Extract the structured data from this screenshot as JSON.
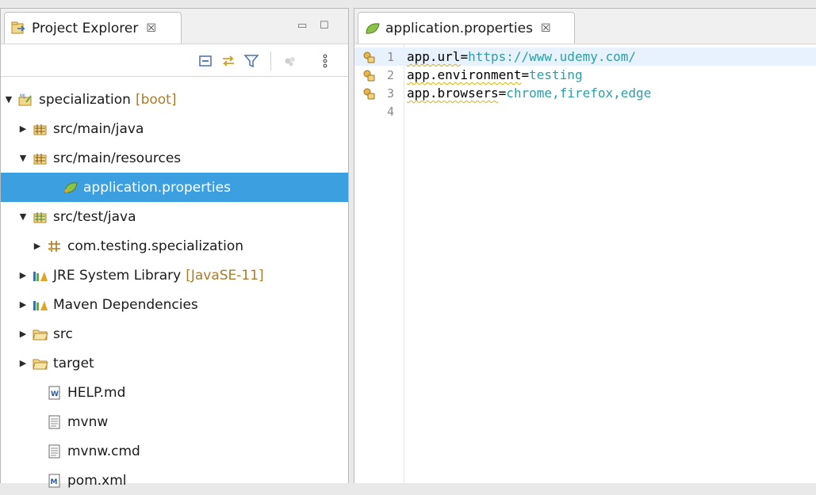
{
  "project_explorer": {
    "tab_label": "Project Explorer",
    "tab_close": "☒",
    "toolbar": {
      "collapse_all": "collapse-all-icon",
      "link_with_editor": "link-with-editor-icon",
      "filter": "filter-icon",
      "focus": "focus-icon",
      "view_menu": "view-menu-icon"
    },
    "tree": [
      {
        "label": "specialization",
        "decoration": "[boot]",
        "expanded": true,
        "icon": "boot-project-icon"
      },
      {
        "label": "src/main/java",
        "expanded": false,
        "icon": "source-folder-icon"
      },
      {
        "label": "src/main/resources",
        "expanded": true,
        "icon": "source-folder-icon"
      },
      {
        "label": "application.properties",
        "selected": true,
        "icon": "spring-properties-icon"
      },
      {
        "label": "src/test/java",
        "expanded": true,
        "icon": "test-source-folder-icon"
      },
      {
        "label": "com.testing.specialization",
        "expanded": false,
        "icon": "package-icon"
      },
      {
        "label": "JRE System Library",
        "decoration": "[JavaSE-11]",
        "expanded": false,
        "icon": "library-icon"
      },
      {
        "label": "Maven Dependencies",
        "expanded": false,
        "icon": "library-icon"
      },
      {
        "label": "src",
        "expanded": false,
        "icon": "folder-icon"
      },
      {
        "label": "target",
        "expanded": false,
        "icon": "folder-icon"
      },
      {
        "label": "HELP.md",
        "icon": "markdown-file-icon"
      },
      {
        "label": "mvnw",
        "icon": "text-file-icon"
      },
      {
        "label": "mvnw.cmd",
        "icon": "text-file-icon"
      },
      {
        "label": "pom.xml",
        "icon": "maven-pom-icon"
      }
    ]
  },
  "editor": {
    "tab_label": "application.properties",
    "tab_close": "☒",
    "lines": [
      {
        "number": "1",
        "key": "app.url",
        "value": "https://www.udemy.com/",
        "warning": true
      },
      {
        "number": "2",
        "key": "app.environment",
        "value": "testing",
        "warning": true
      },
      {
        "number": "3",
        "key": "app.browsers",
        "value": "chrome,firefox,edge",
        "warning": true
      },
      {
        "number": "4",
        "key": "",
        "value": "",
        "warning": false
      }
    ]
  },
  "colors": {
    "selection": "#3c9fe0",
    "property_value": "#2a9fa5",
    "decoration": "#a87d2c",
    "current_line": "#e8f2fe"
  }
}
